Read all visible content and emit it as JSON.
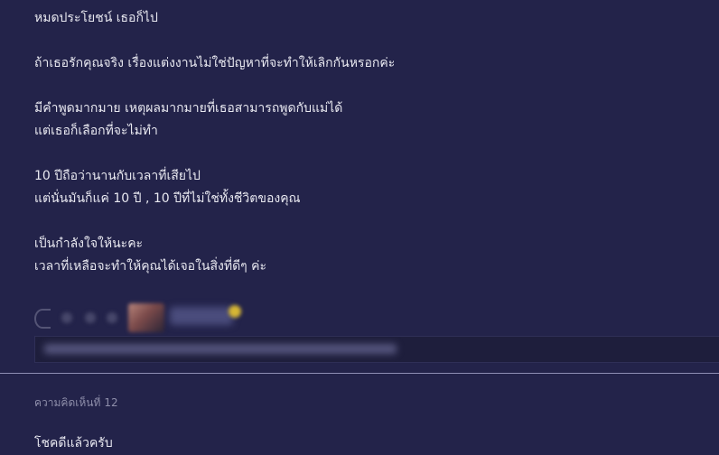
{
  "post": {
    "paragraphs": [
      [
        "หมดประโยชน์ เธอก็ไป"
      ],
      [
        "ถ้าเธอรักคุณจริง เรื่องแต่งงานไม่ใช่ปัญหาที่จะทำให้เลิกกันหรอกค่ะ"
      ],
      [
        "มีคำพูดมากมาย เหตุผลมากมายที่เธอสามารถพูดกับแม่ได้",
        "แต่เธอก็เลือกที่จะไม่ทำ"
      ],
      [
        "10 ปีถือว่านานกับเวลาที่เสียไป",
        "แต่นั่นมันก็แค่ 10 ปี , 10 ปีที่ไม่ใช่ทั้งชีวิตของคุณ"
      ],
      [
        "เป็นกำลังใจให้นะคะ",
        "เวลาที่เหลือจะทำให้คุณได้เจอในสิ่งที่ดีๆ ค่ะ"
      ]
    ]
  },
  "comments": {
    "header_label": "ความคิดเห็นที่",
    "number": "12",
    "text": "โชคดีแล้วครับ"
  },
  "icons": {
    "reaction": "emoji-reaction-icon",
    "verified": "badge-icon"
  },
  "colors": {
    "background": "#23234a",
    "divider": "#8f8fb4",
    "text": "#e8e8f0",
    "muted": "#8e8eaa"
  }
}
